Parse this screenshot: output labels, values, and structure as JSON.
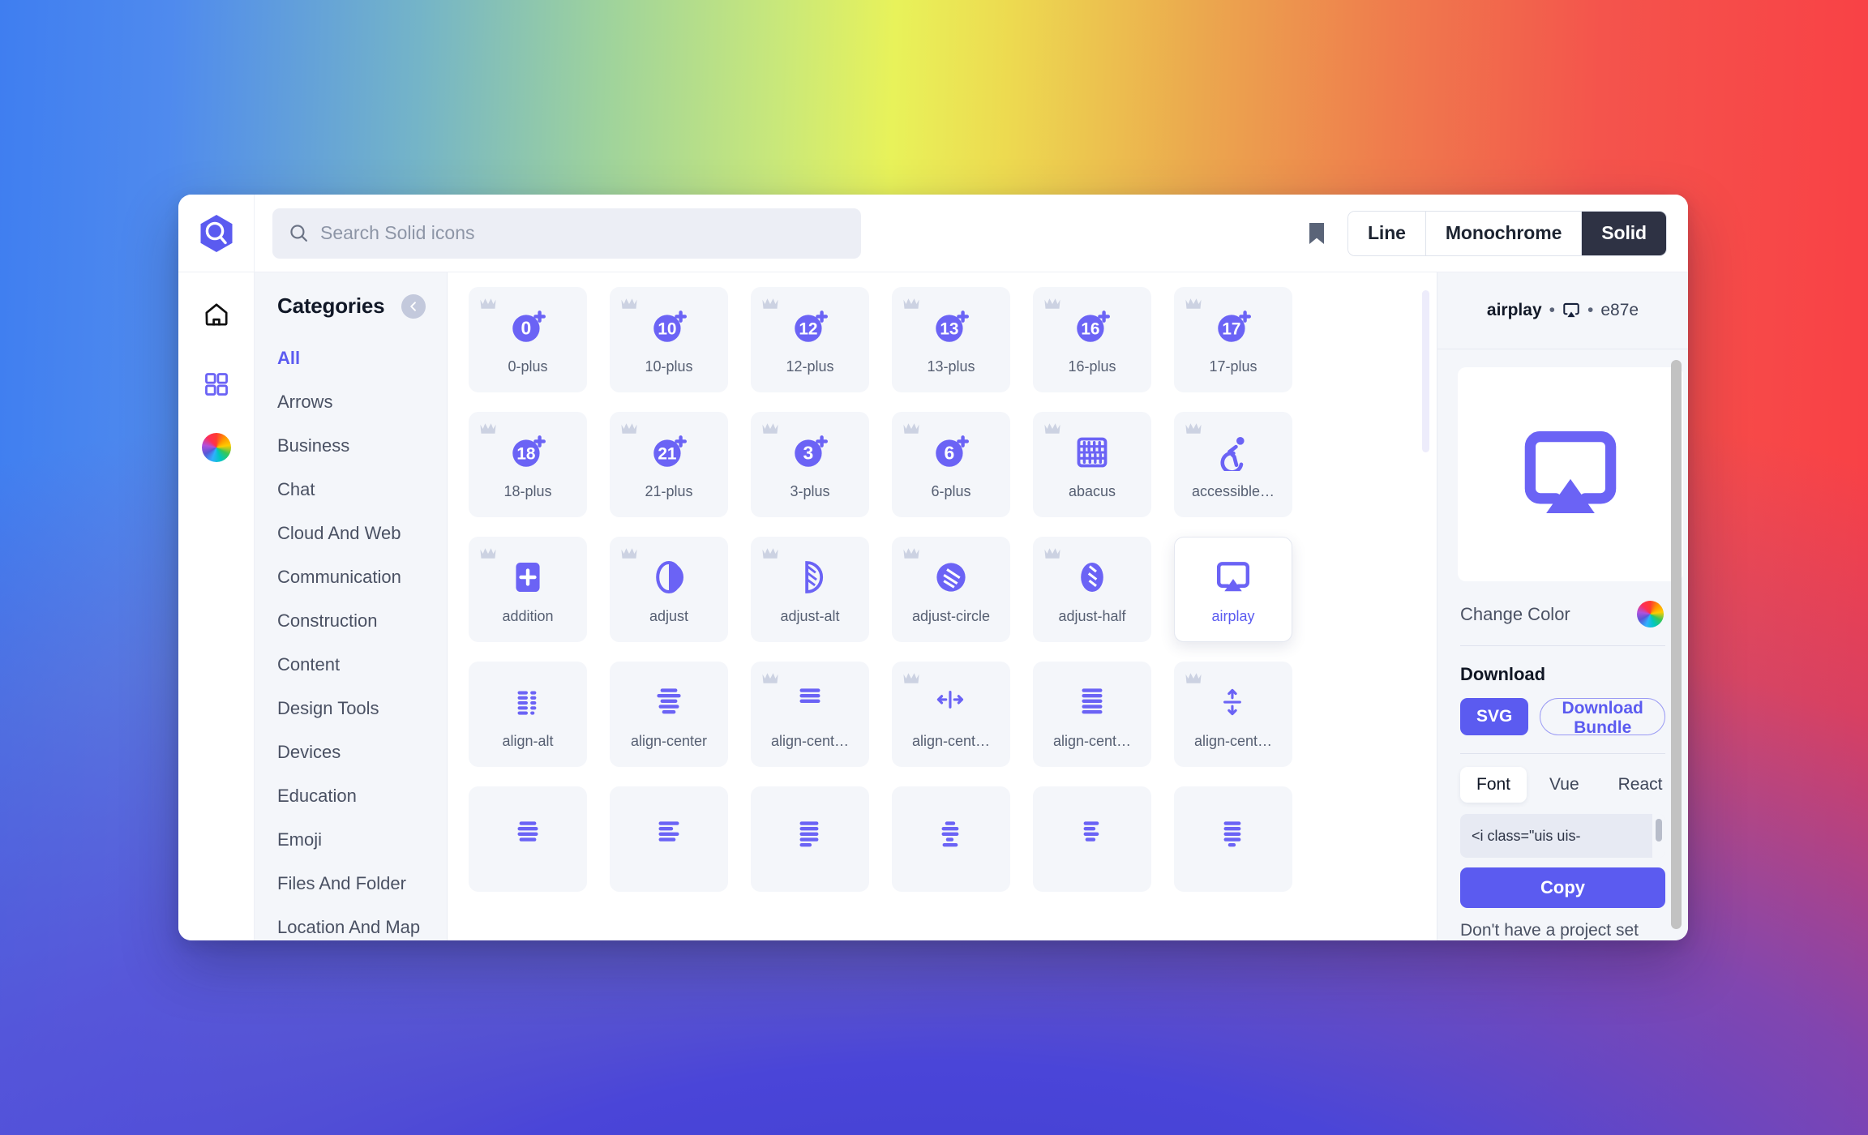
{
  "app": {
    "logo": "hexagon-search-logo"
  },
  "search": {
    "placeholder": "Search Solid icons",
    "value": "",
    "icon": "search-icon"
  },
  "toolbar": {
    "bookmark_icon": "bookmark-icon",
    "style_options": [
      {
        "label": "Line",
        "active": false
      },
      {
        "label": "Monochrome",
        "active": false
      },
      {
        "label": "Solid",
        "active": true
      }
    ]
  },
  "rail": {
    "items": [
      {
        "icon": "home-icon",
        "name": "home"
      },
      {
        "icon": "grid-icon",
        "name": "browse"
      },
      {
        "icon": "color-wheel-icon",
        "name": "color"
      }
    ]
  },
  "sidebar": {
    "title": "Categories",
    "collapse_icon": "chevron-left-icon",
    "items": [
      {
        "label": "All",
        "active": true
      },
      {
        "label": "Arrows",
        "active": false
      },
      {
        "label": "Business",
        "active": false
      },
      {
        "label": "Chat",
        "active": false
      },
      {
        "label": "Cloud And Web",
        "active": false
      },
      {
        "label": "Communication",
        "active": false
      },
      {
        "label": "Construction",
        "active": false
      },
      {
        "label": "Content",
        "active": false
      },
      {
        "label": "Design Tools",
        "active": false
      },
      {
        "label": "Devices",
        "active": false
      },
      {
        "label": "Education",
        "active": false
      },
      {
        "label": "Emoji",
        "active": false
      },
      {
        "label": "Files And Folder",
        "active": false
      },
      {
        "label": "Location And Map",
        "active": false
      }
    ]
  },
  "grid": {
    "icons": [
      {
        "label": "0-plus",
        "art": "num-plus",
        "num": "0",
        "pro": true,
        "selected": false
      },
      {
        "label": "10-plus",
        "art": "num-plus",
        "num": "10",
        "pro": true,
        "selected": false
      },
      {
        "label": "12-plus",
        "art": "num-plus",
        "num": "12",
        "pro": true,
        "selected": false
      },
      {
        "label": "13-plus",
        "art": "num-plus",
        "num": "13",
        "pro": true,
        "selected": false
      },
      {
        "label": "16-plus",
        "art": "num-plus",
        "num": "16",
        "pro": true,
        "selected": false
      },
      {
        "label": "17-plus",
        "art": "num-plus",
        "num": "17",
        "pro": true,
        "selected": false
      },
      {
        "label": "18-plus",
        "art": "num-plus",
        "num": "18",
        "pro": true,
        "selected": false
      },
      {
        "label": "21-plus",
        "art": "num-plus",
        "num": "21",
        "pro": true,
        "selected": false
      },
      {
        "label": "3-plus",
        "art": "num-plus",
        "num": "3",
        "pro": true,
        "selected": false
      },
      {
        "label": "6-plus",
        "art": "num-plus",
        "num": "6",
        "pro": true,
        "selected": false
      },
      {
        "label": "abacus",
        "art": "abacus",
        "pro": true,
        "selected": false
      },
      {
        "label": "accessible…",
        "art": "accessible",
        "pro": true,
        "selected": false
      },
      {
        "label": "addition",
        "art": "addition",
        "pro": true,
        "selected": false
      },
      {
        "label": "adjust",
        "art": "adjust",
        "pro": true,
        "selected": false
      },
      {
        "label": "adjust-alt",
        "art": "adjust-alt",
        "pro": true,
        "selected": false
      },
      {
        "label": "adjust-circle",
        "art": "adjust-circle",
        "pro": true,
        "selected": false
      },
      {
        "label": "adjust-half",
        "art": "adjust-half",
        "pro": true,
        "selected": false
      },
      {
        "label": "airplay",
        "art": "airplay",
        "pro": false,
        "selected": true
      },
      {
        "label": "align-alt",
        "art": "align-alt",
        "pro": false,
        "selected": false
      },
      {
        "label": "align-center",
        "art": "align-center",
        "pro": false,
        "selected": false
      },
      {
        "label": "align-cent…",
        "art": "align-center-2",
        "pro": true,
        "selected": false
      },
      {
        "label": "align-cent…",
        "art": "align-h",
        "pro": true,
        "selected": false
      },
      {
        "label": "align-cent…",
        "art": "align-justify",
        "pro": false,
        "selected": false
      },
      {
        "label": "align-cent…",
        "art": "align-v",
        "pro": true,
        "selected": false
      },
      {
        "label": "",
        "art": "align-rows-a",
        "pro": false,
        "selected": false
      },
      {
        "label": "",
        "art": "align-rows-b",
        "pro": false,
        "selected": false
      },
      {
        "label": "",
        "art": "align-rows-c",
        "pro": false,
        "selected": false
      },
      {
        "label": "",
        "art": "align-rows-d",
        "pro": false,
        "selected": false
      },
      {
        "label": "",
        "art": "align-rows-e",
        "pro": false,
        "selected": false
      },
      {
        "label": "",
        "art": "align-rows-f",
        "pro": false,
        "selected": false
      }
    ]
  },
  "detail": {
    "name": "airplay",
    "separator": "•",
    "glyph_icon": "airplay-icon",
    "unicode": "e87e",
    "preview_icon": "airplay-icon",
    "change_color_label": "Change Color",
    "color_wheel_icon": "color-wheel-icon",
    "download_title": "Download",
    "svg_label": "SVG",
    "bundle_label": "Download Bundle",
    "framework_tabs": [
      {
        "label": "Font",
        "active": true
      },
      {
        "label": "Vue",
        "active": false
      },
      {
        "label": "React",
        "active": false
      }
    ],
    "code_snippet": "<i class=\"uis uis-",
    "copy_label": "Copy",
    "footer_note": "Don't have a project set"
  },
  "colors": {
    "accent": "#5b5bf0",
    "dark": "#2e3244",
    "panel": "#f4f6fa",
    "text": "#4a5163"
  }
}
